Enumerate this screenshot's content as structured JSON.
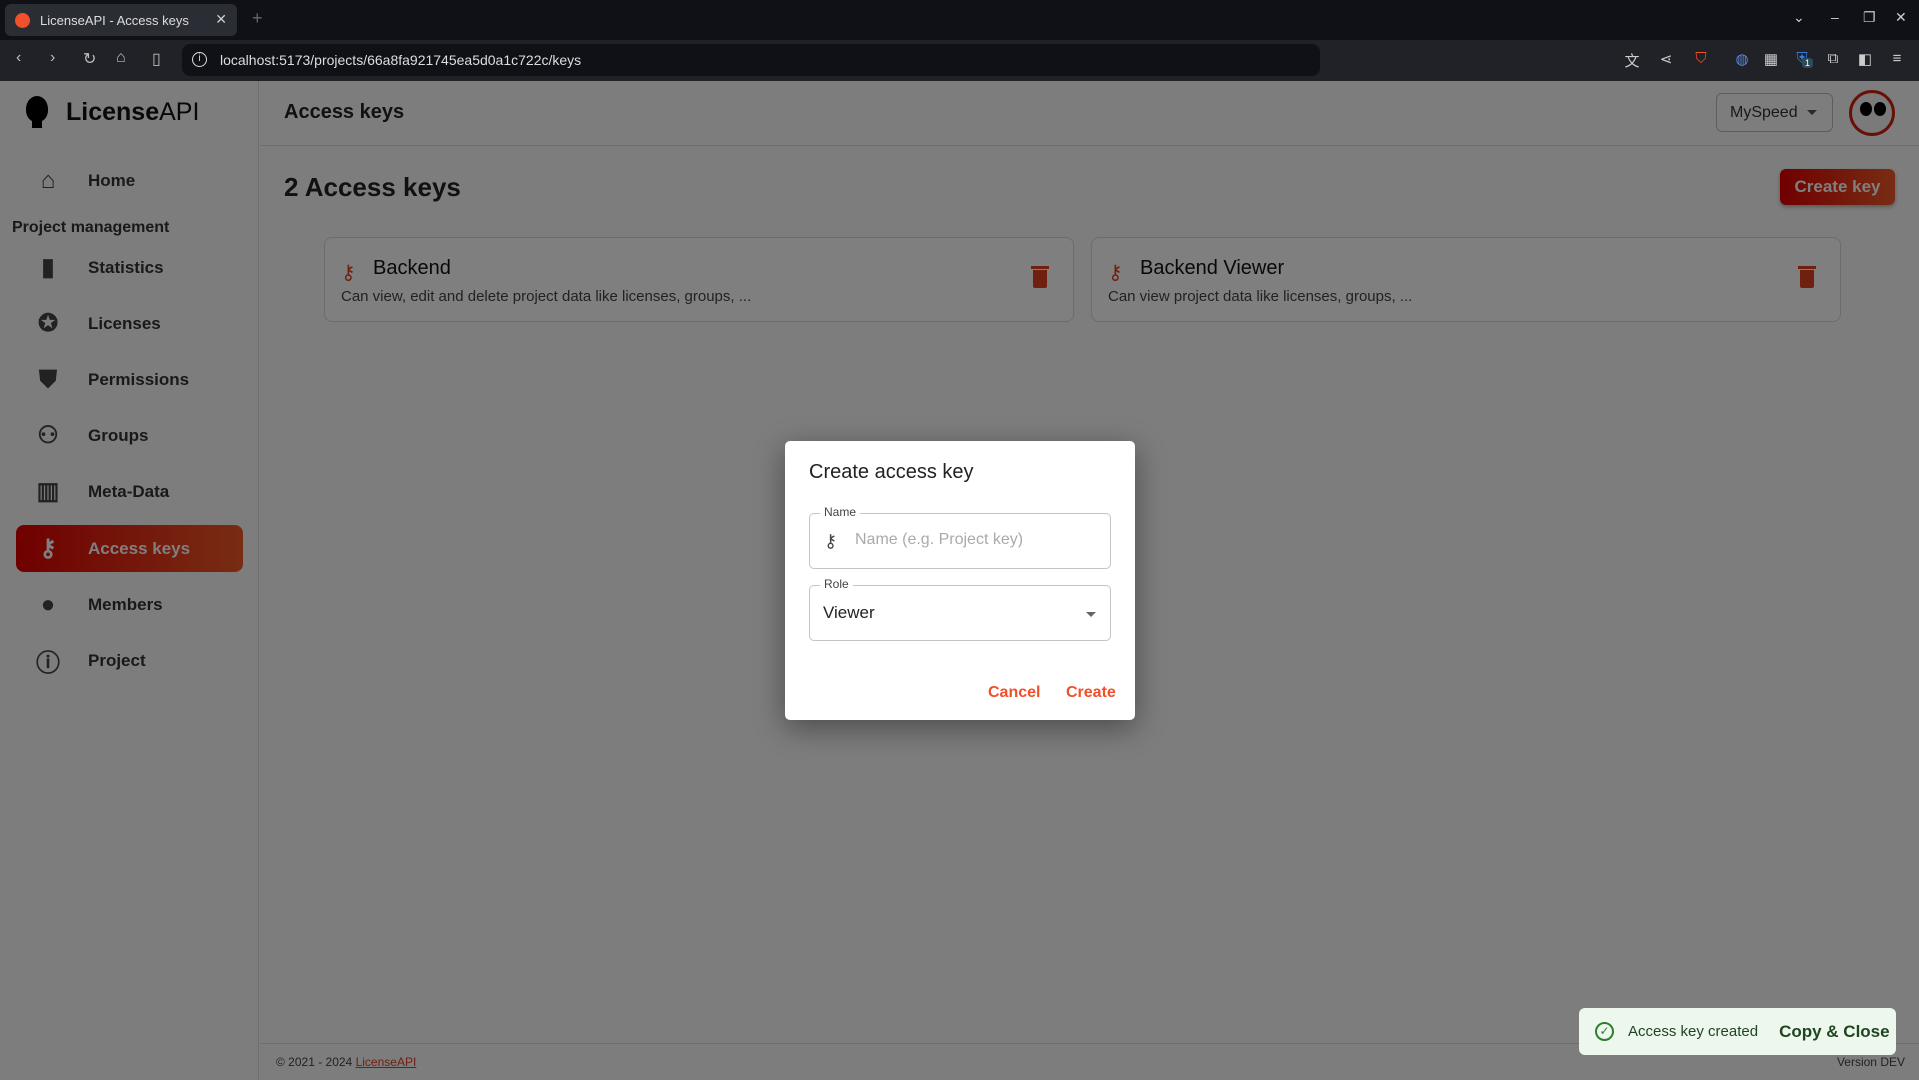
{
  "browser": {
    "tab_title": "LicenseAPI - Access keys",
    "url": "localhost:5173/projects/66a8fa921745ea5d0a1c722c/keys",
    "extension_badge": "1"
  },
  "sidebar": {
    "logo_bold": "License",
    "logo_rest": "API",
    "home": "Home",
    "section": "Project management",
    "items": [
      {
        "label": "Statistics",
        "icon": "bar-chart-icon"
      },
      {
        "label": "Licenses",
        "icon": "badge-icon"
      },
      {
        "label": "Permissions",
        "icon": "shield-icon"
      },
      {
        "label": "Groups",
        "icon": "group-icon"
      },
      {
        "label": "Meta-Data",
        "icon": "table-icon"
      },
      {
        "label": "Access keys",
        "icon": "key-icon",
        "active": true
      },
      {
        "label": "Members",
        "icon": "person-icon"
      },
      {
        "label": "Project",
        "icon": "info-icon"
      }
    ]
  },
  "header": {
    "title": "Access keys",
    "project": "MySpeed"
  },
  "main": {
    "count_title": "2 Access keys",
    "create_label": "Create key",
    "keys": [
      {
        "name": "Backend",
        "description": "Can view, edit and delete project data like licenses, groups, ..."
      },
      {
        "name": "Backend Viewer",
        "description": "Can view project data like licenses, groups, ..."
      }
    ]
  },
  "dialog": {
    "title": "Create access key",
    "name_label": "Name",
    "name_placeholder": "Name (e.g. Project key)",
    "name_value": "",
    "role_label": "Role",
    "role_value": "Viewer",
    "cancel": "Cancel",
    "create": "Create"
  },
  "footer": {
    "copyright": "© 2021 - 2024 ",
    "link": "LicenseAPI",
    "version": "Version DEV"
  },
  "toast": {
    "message": "Access key created",
    "action": "Copy & Close"
  },
  "colors": {
    "accent": "#f0502a",
    "success": "#2e7d32"
  }
}
